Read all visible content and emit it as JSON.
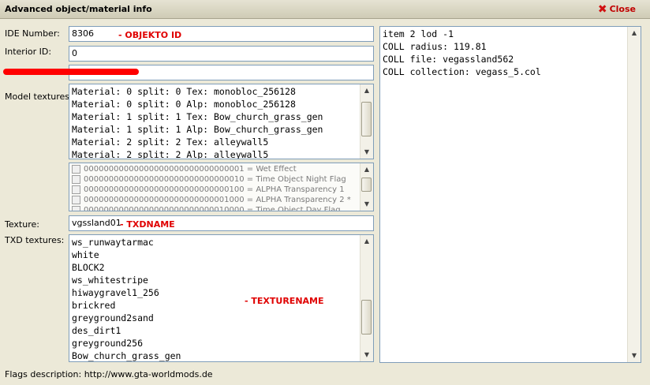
{
  "window": {
    "title": "Advanced object/material info",
    "close_label": "Close"
  },
  "fields": {
    "ide_label": "IDE Number:",
    "ide_value": "8306",
    "interior_label": "Interior ID:",
    "interior_value": "0",
    "third_value": "",
    "model_textures_label": "Model textures:",
    "texture_label": "Texture:",
    "texture_value": "vgssland01",
    "txd_label": "TXD textures:"
  },
  "annotations": {
    "ide": "- OBJEKTO ID",
    "txd": "- TXDNAME",
    "texture": "- TEXTURENAME"
  },
  "model_textures": [
    "Material: 0 split: 0 Tex: monobloc_256128",
    "Material: 0 split: 0 Alp: monobloc_256128",
    "Material: 1 split: 1 Tex: Bow_church_grass_gen",
    "Material: 1 split: 1 Alp: Bow_church_grass_gen",
    "Material: 2 split: 2 Tex: alleywall5",
    "Material: 2 split: 2 Alp: alleywall5"
  ],
  "flags": [
    "00000000000000000000000000000001 = Wet Effect",
    "00000000000000000000000000000010 = Time Object Night Flag",
    "00000000000000000000000000000100 = ALPHA Transparency 1",
    "00000000000000000000000000001000 = ALPHA Transparency 2 *",
    "00000000000000000000000000010000 = Time Object Day Flag"
  ],
  "txd_textures": [
    "ws_runwaytarmac",
    "white",
    "BLOCK2",
    "ws_whitestripe",
    "hiwaygravel1_256",
    "brickred",
    "greyground2sand",
    "des_dirt1",
    "greyground256",
    "Bow_church_grass_gen"
  ],
  "info_lines": [
    "item 2 lod -1",
    "COLL radius: 119.81",
    "COLL file: vegassland562",
    "COLL collection: vegass_5.col"
  ],
  "footer": {
    "flags_description": "Flags description: http://www.gta-worldmods.de"
  },
  "colors": {
    "annotation": "#e00000",
    "close": "#c00000"
  }
}
